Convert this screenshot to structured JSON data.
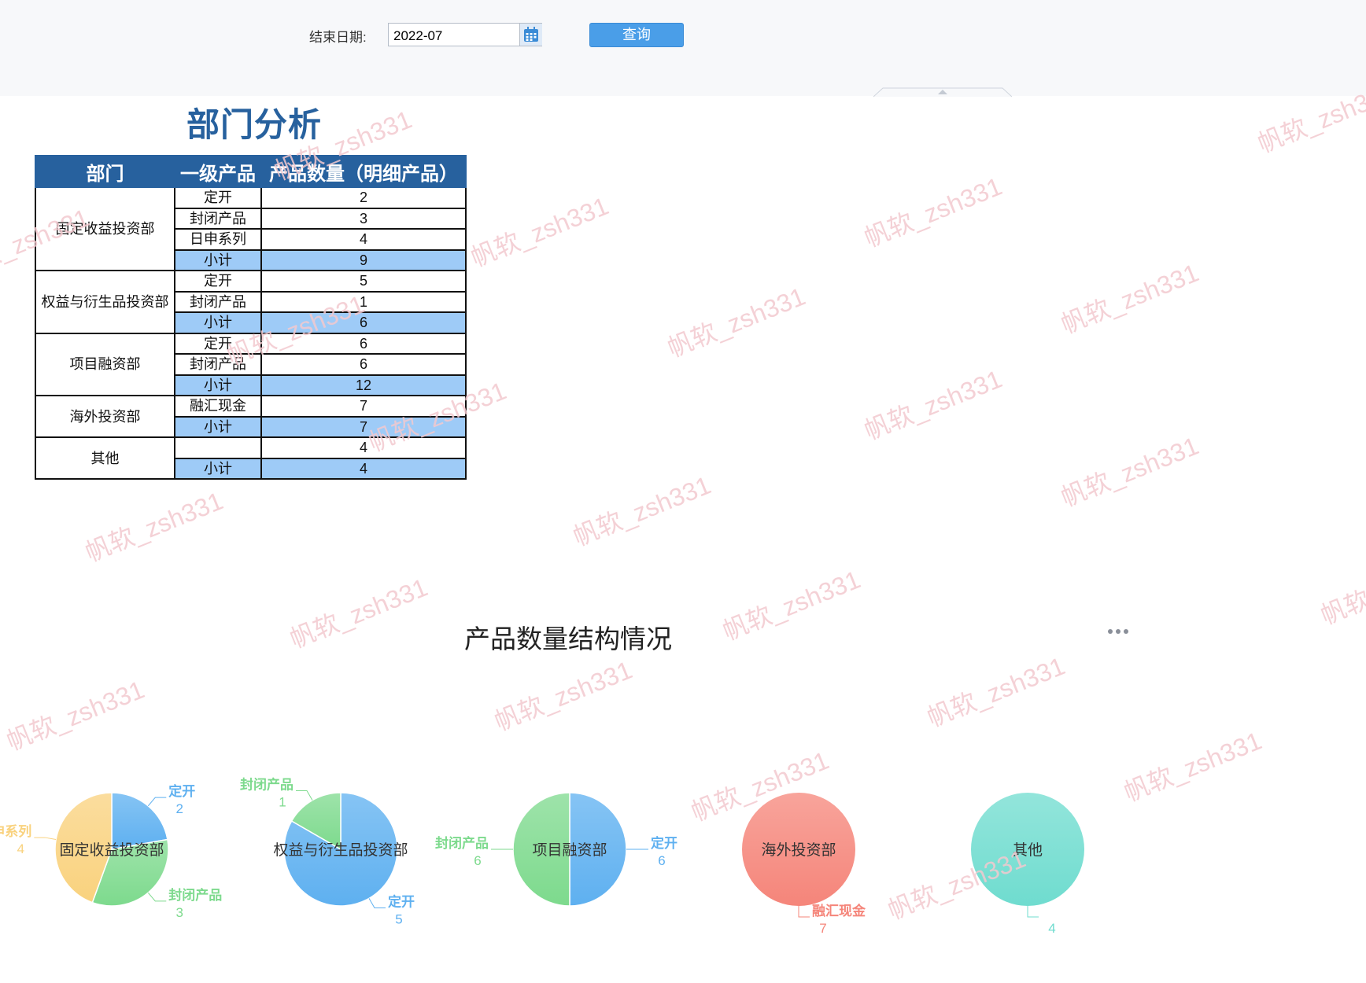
{
  "toolbar": {
    "end_date_label": "结束日期:",
    "end_date_value": "2022-07",
    "query_button": "查询",
    "calendar_icon": "calendar-icon"
  },
  "report": {
    "title": "部门分析",
    "header": {
      "dept": "部门",
      "product": "一级产品",
      "count": "产品数量（明细产品）"
    },
    "departments": [
      {
        "name": "固定收益投资部",
        "rows": [
          {
            "product": "定开",
            "count": "2"
          },
          {
            "product": "封闭产品",
            "count": "3"
          },
          {
            "product": "日申系列",
            "count": "4"
          },
          {
            "product": "小计",
            "count": "9",
            "subtotal": true
          }
        ]
      },
      {
        "name": "权益与衍生品投资部",
        "rows": [
          {
            "product": "定开",
            "count": "5"
          },
          {
            "product": "封闭产品",
            "count": "1"
          },
          {
            "product": "小计",
            "count": "6",
            "subtotal": true
          }
        ]
      },
      {
        "name": "项目融资部",
        "rows": [
          {
            "product": "定开",
            "count": "6"
          },
          {
            "product": "封闭产品",
            "count": "6"
          },
          {
            "product": "小计",
            "count": "12",
            "subtotal": true
          }
        ]
      },
      {
        "name": "海外投资部",
        "rows": [
          {
            "product": "融汇现金",
            "count": "7"
          },
          {
            "product": "小计",
            "count": "7",
            "subtotal": true
          }
        ]
      },
      {
        "name": "其他",
        "rows": [
          {
            "product": "",
            "count": "4"
          },
          {
            "product": "小计",
            "count": "4",
            "subtotal": true
          }
        ]
      }
    ]
  },
  "chart_data": {
    "type": "pie",
    "title": "产品数量结构情况",
    "more_menu_icon": "more-dots-icon",
    "colors": {
      "定开": "#5eb0f0",
      "封闭产品": "#7dda8d",
      "日申系列": "#f9d27e",
      "融汇现金": "#f5857a",
      "其他": "#6fdccf"
    },
    "pies": [
      {
        "name": "固定收益投资部",
        "slices": [
          {
            "label": "定开",
            "value": 2
          },
          {
            "label": "封闭产品",
            "value": 3
          },
          {
            "label": "日申系列",
            "value": 4
          }
        ]
      },
      {
        "name": "权益与衍生品投资部",
        "slices": [
          {
            "label": "定开",
            "value": 5
          },
          {
            "label": "封闭产品",
            "value": 1
          }
        ]
      },
      {
        "name": "项目融资部",
        "slices": [
          {
            "label": "定开",
            "value": 6
          },
          {
            "label": "封闭产品",
            "value": 6
          }
        ]
      },
      {
        "name": "海外投资部",
        "slices": [
          {
            "label": "融汇现金",
            "value": 7
          }
        ]
      },
      {
        "name": "其他",
        "slices": [
          {
            "label": "",
            "value": 4
          }
        ]
      }
    ]
  },
  "watermark": {
    "text": "帆软_zsh331",
    "color": "#f3c9cf"
  }
}
